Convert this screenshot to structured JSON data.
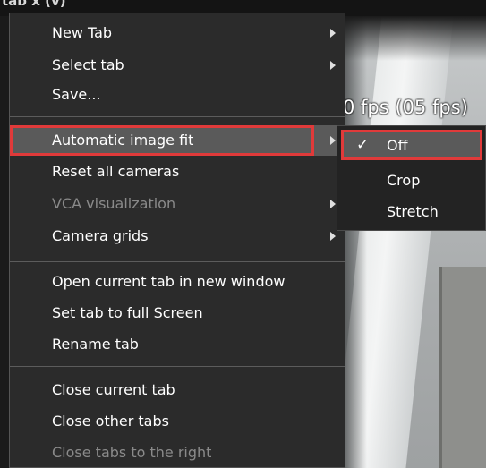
{
  "tab_strip": {
    "fragment": "tab x (v)"
  },
  "camera_view": {
    "fps_text": "0 fps (05 fps)"
  },
  "context_menu": {
    "items": [
      {
        "label": "New Tab",
        "has_submenu": true,
        "enabled": true
      },
      {
        "label": "Select tab",
        "has_submenu": true,
        "enabled": true
      },
      {
        "label": "Save...",
        "has_submenu": false,
        "enabled": true
      },
      {
        "label": "Automatic image fit",
        "has_submenu": true,
        "enabled": true,
        "highlighted": true
      },
      {
        "label": "Reset all cameras",
        "has_submenu": false,
        "enabled": true
      },
      {
        "label": "VCA visualization",
        "has_submenu": true,
        "enabled": false
      },
      {
        "label": "Camera grids",
        "has_submenu": true,
        "enabled": true
      },
      {
        "label": "Open current tab in new window",
        "has_submenu": false,
        "enabled": true
      },
      {
        "label": "Set tab to full Screen",
        "has_submenu": false,
        "enabled": true
      },
      {
        "label": "Rename tab",
        "has_submenu": false,
        "enabled": true
      },
      {
        "label": "Close current tab",
        "has_submenu": false,
        "enabled": true
      },
      {
        "label": "Close other tabs",
        "has_submenu": false,
        "enabled": true
      },
      {
        "label": "Close tabs to the right",
        "has_submenu": false,
        "enabled": false
      }
    ]
  },
  "submenu": {
    "items": [
      {
        "label": "Off",
        "checked": true
      },
      {
        "label": "Crop",
        "checked": false
      },
      {
        "label": "Stretch",
        "checked": false
      }
    ],
    "check_glyph": "✓"
  },
  "colors": {
    "highlight_border": "#e03a3a",
    "menu_bg": "#2b2b2b",
    "hover_bg": "#5a5a5a",
    "disabled_text": "#8a8a8a"
  }
}
